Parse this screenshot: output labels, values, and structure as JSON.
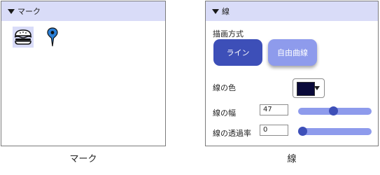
{
  "mark_panel": {
    "header": "マーク",
    "icons": [
      "hamburger-icon",
      "map-pin-icon"
    ],
    "caption": "マーク"
  },
  "line_panel": {
    "header": "線",
    "draw_method_label": "描画方式",
    "buttons": {
      "line": "ライン",
      "freehand": "自由曲線"
    },
    "color_label": "線の色",
    "color_value": "#0a0a3a",
    "width_label": "線の幅",
    "width_value": "47",
    "width_fraction": 0.47,
    "opacity_label": "線の透過率",
    "opacity_value": "0",
    "opacity_fraction": 0.0,
    "caption": "線"
  },
  "colors": {
    "header_bg": "#d9dcf8",
    "primary": "#3d4fb8",
    "secondary": "#8e9bec"
  }
}
